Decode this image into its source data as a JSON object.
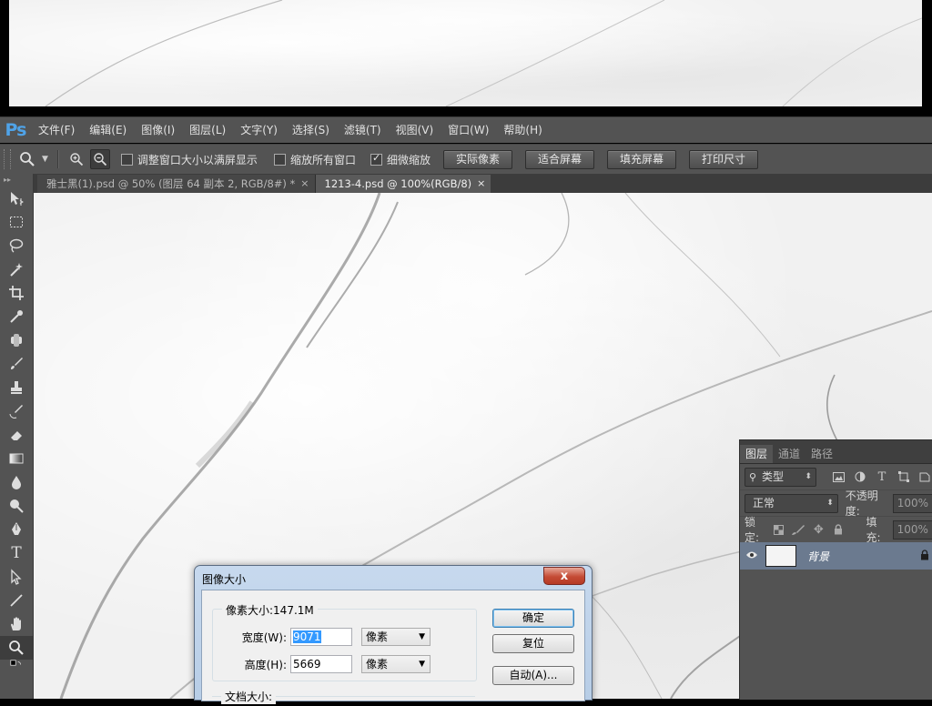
{
  "app": {
    "logo": "Ps"
  },
  "menu": [
    "文件(F)",
    "编辑(E)",
    "图像(I)",
    "图层(L)",
    "文字(Y)",
    "选择(S)",
    "滤镜(T)",
    "视图(V)",
    "窗口(W)",
    "帮助(H)"
  ],
  "options": {
    "checkbox_resize": {
      "label": "调整窗口大小以满屏显示",
      "checked": false
    },
    "checkbox_all_windows": {
      "label": "缩放所有窗口",
      "checked": false
    },
    "checkbox_scrubby": {
      "label": "细微缩放",
      "checked": true
    },
    "buttons": [
      "实际像素",
      "适合屏幕",
      "填充屏幕",
      "打印尺寸"
    ]
  },
  "tabs": [
    {
      "title": "雅士黑(1).psd @ 50% (图层 64 副本 2, RGB/8#) *",
      "close": "×",
      "active": false
    },
    {
      "title": "1213-4.psd @ 100%(RGB/8)",
      "close": "×",
      "active": true
    }
  ],
  "layers_panel": {
    "tabs": [
      "图层",
      "通道",
      "路径"
    ],
    "filter_label": "类型",
    "blend_mode": "正常",
    "opacity_label": "不透明度:",
    "opacity_value": "100%",
    "lock_label": "锁定:",
    "fill_label": "填充:",
    "fill_value": "100%",
    "layer_name": "背景"
  },
  "dialog": {
    "title": "图像大小",
    "close": "x",
    "pixel_dimensions": "像素大小:147.1M",
    "width_label": "宽度(W):",
    "width_value": "9071",
    "width_unit": "像素",
    "height_label": "高度(H):",
    "height_value": "5669",
    "height_unit": "像素",
    "ok": "确定",
    "reset": "复位",
    "auto": "自动(A)...",
    "document_size": "文档大小:"
  },
  "colors": {
    "ui_bg": "#535353",
    "ps_blue": "#4fa3e8",
    "layer_selected": "#6b7a8f"
  }
}
